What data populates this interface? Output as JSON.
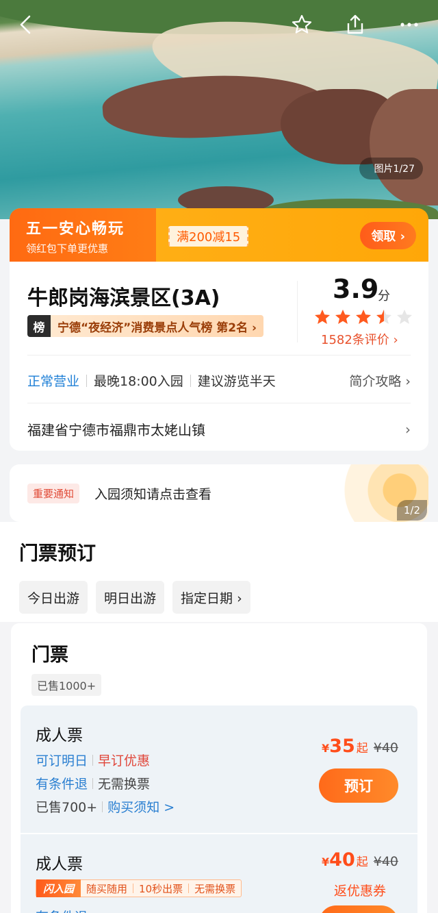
{
  "hero": {
    "image_counter": "图片1/27"
  },
  "topbar": {
    "icons": [
      "back-icon",
      "star-icon",
      "share-icon",
      "more-icon"
    ]
  },
  "promo": {
    "title": "五一安心畅玩",
    "subtitle": "领红包下单更优惠",
    "coupon": "满200减15",
    "claim_button": "领取 ›"
  },
  "attraction": {
    "name": "牛郎岗海滨景区(3A)",
    "rank_badge": "榜",
    "rank_text": "宁德“夜经济”消费景点人气榜 第2名 ›",
    "score": "3.9",
    "score_unit": "分",
    "stars_filled": 3.5,
    "stars_total": 5,
    "reviews": "1582条评价 ›",
    "status": "正常营业",
    "last_entry": "最晚18:00入园",
    "suggestion": "建议游览半天",
    "guide_link": "简介攻略 ›",
    "address": "福建省宁德市福鼎市太姥山镇",
    "address_chevron": "›"
  },
  "notice": {
    "tag": "重要通知",
    "text": "入园须知请点击查看",
    "page": "1/2"
  },
  "tickets": {
    "section_title": "门票预订",
    "date_tabs": [
      "今日出游",
      "明日出游",
      "指定日期 ›"
    ],
    "category_title": "门票",
    "category_sold": "已售1000+",
    "items": [
      {
        "name": "成人票",
        "tag1": "可订明日",
        "tag2": "早订优惠",
        "refund": "有条件退",
        "exchange": "无需换票",
        "sold": "已售700+",
        "notice_link": "购买须知 >",
        "currency": "¥",
        "price": "35",
        "price_suffix": "起",
        "original_price": "¥40",
        "button": "预订"
      },
      {
        "name": "成人票",
        "flash_logo": "闪入园",
        "flash_tags": [
          "随买随用",
          "10秒出票",
          "无需换票"
        ],
        "refund": "有条件退",
        "currency": "¥",
        "price": "40",
        "price_suffix": "起",
        "original_price": "¥40",
        "cashback": "返优惠券"
      }
    ]
  },
  "colors": {
    "accent_orange": "#ff6a1a",
    "link_blue": "#2a7fd1",
    "star_orange": "#ff5a1f"
  }
}
